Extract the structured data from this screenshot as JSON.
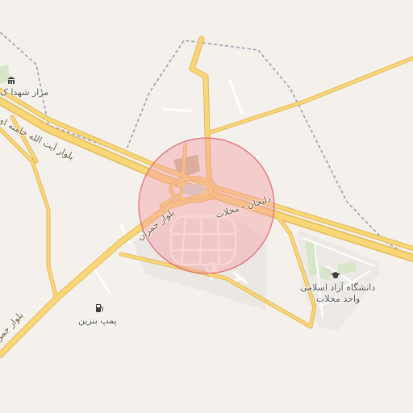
{
  "map": {
    "highlight_circle": {
      "fill": "#f4a0a6",
      "stroke": "#e06b74"
    },
    "road_color": "#fad776",
    "road_casing": "#e3b95a",
    "boundary_color": "#9aa0b4"
  },
  "labels": {
    "martyrs_cemetery": "مزار شهدا ک",
    "boulevard_khamenei": "بلوار آیت الله خامنه ای",
    "delijan_mahallat": "دلیجان - محلات",
    "boulevard_jamran": "بلوار جمران",
    "boulevard_jamran_sw": "بلوار جمر",
    "gas_station": "پمپ بنزین",
    "university_line1": "دانشگاه آزاد اسلامی",
    "university_line2": "واحد محلات"
  },
  "icons": {
    "cemetery": "museum-icon",
    "gas_station": "fuel-pump-icon",
    "university": "graduation-cap-icon"
  }
}
